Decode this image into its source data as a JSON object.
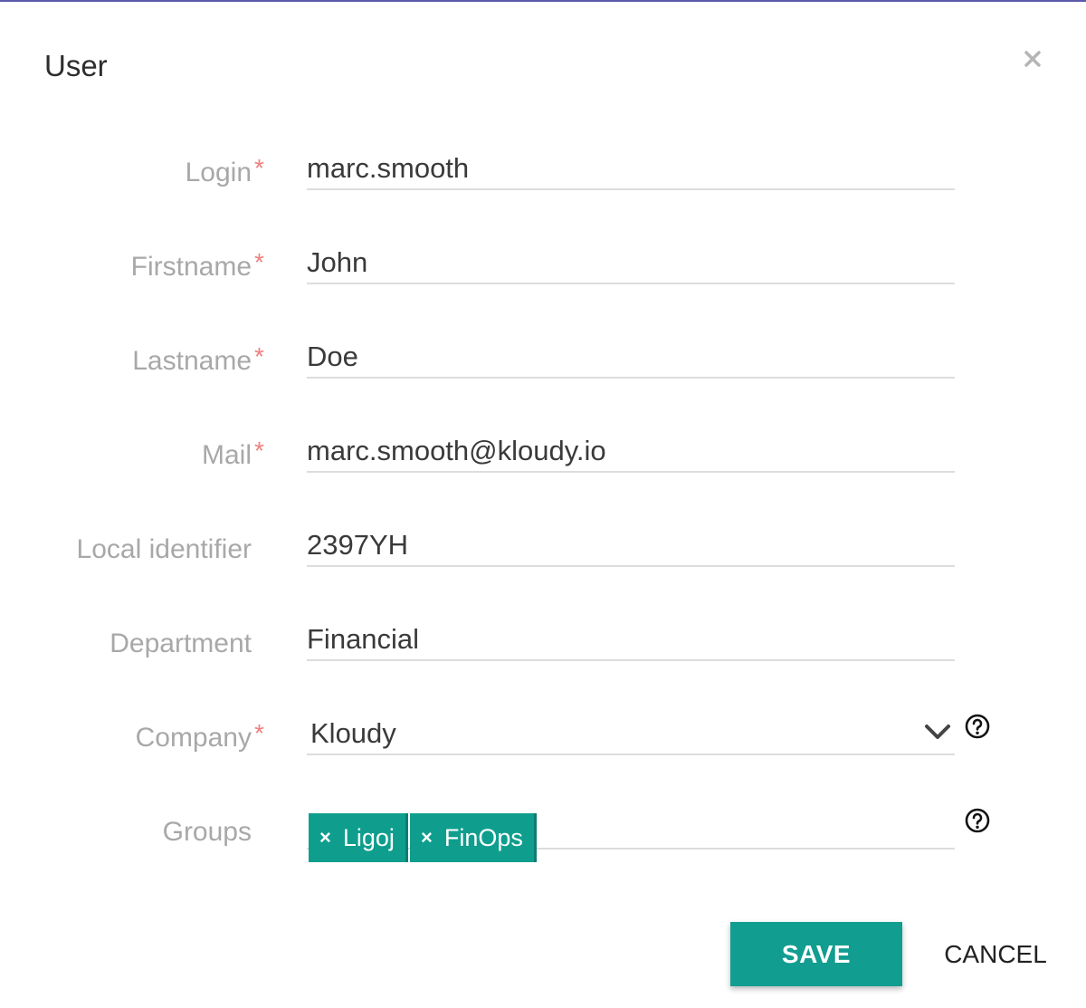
{
  "dialog": {
    "title": "User",
    "close_icon": "close-icon"
  },
  "fields": {
    "login": {
      "label": "Login",
      "required_mark": "*",
      "value": "marc.smooth"
    },
    "firstname": {
      "label": "Firstname",
      "required_mark": "*",
      "value": "John"
    },
    "lastname": {
      "label": "Lastname",
      "required_mark": "*",
      "value": "Doe"
    },
    "mail": {
      "label": "Mail",
      "required_mark": "*",
      "value": "marc.smooth@kloudy.io"
    },
    "local_identifier": {
      "label": "Local identifier",
      "value": "2397YH"
    },
    "department": {
      "label": "Department",
      "value": "Financial"
    },
    "company": {
      "label": "Company",
      "required_mark": "*",
      "value": "Kloudy",
      "icon": "chevron-down-icon",
      "help_icon": "help-circle-icon"
    },
    "groups": {
      "label": "Groups",
      "tags": [
        {
          "label": "Ligoj",
          "remove_symbol": "×"
        },
        {
          "label": "FinOps",
          "remove_symbol": "×"
        }
      ],
      "help_icon": "help-circle-icon"
    }
  },
  "actions": {
    "save_label": "SAVE",
    "cancel_label": "CANCEL"
  },
  "colors": {
    "accent": "#119d8f",
    "tag_bg": "#0f9e8d",
    "required": "#f07f7f",
    "label": "#a8a8a8"
  }
}
